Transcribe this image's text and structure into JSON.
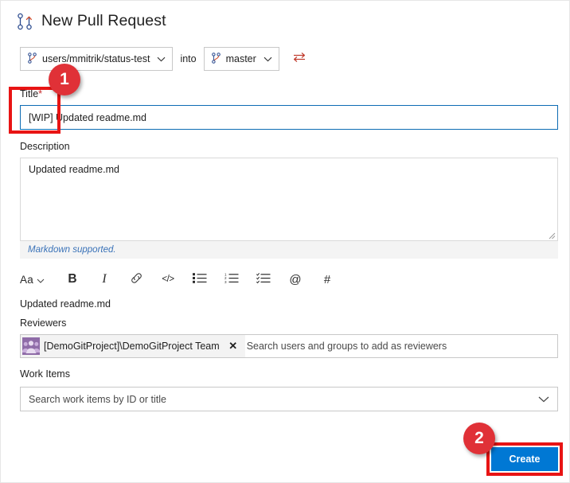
{
  "header": {
    "title": "New Pull Request",
    "icon": "pull-request-icon"
  },
  "branch_row": {
    "source_branch": "users/mmitrik/status-test",
    "into_label": "into",
    "target_branch": "master",
    "swap_icon": "swap-arrows-icon",
    "branch_icon": "branch-icon",
    "chevron_icon": "chevron-down-icon"
  },
  "title_field": {
    "label": "Title",
    "required_marker": "*",
    "value": "[WIP] Updated readme.md",
    "wip_prefix": "[WIP]",
    "rest": " Updated readme.md"
  },
  "description_field": {
    "label": "Description",
    "value": "Updated readme.md",
    "markdown_hint": "Markdown supported."
  },
  "format_toolbar": {
    "buttons": [
      {
        "name": "font-size-button",
        "label": "Aa",
        "icon": "font-size-icon"
      },
      {
        "name": "bold-button",
        "label": "B",
        "icon": "bold-icon"
      },
      {
        "name": "italic-button",
        "label": "I",
        "icon": "italic-icon"
      },
      {
        "name": "link-button",
        "label": "",
        "icon": "link-icon"
      },
      {
        "name": "code-button",
        "label": "</>",
        "icon": "code-icon"
      },
      {
        "name": "bulleted-list-button",
        "label": "",
        "icon": "bulleted-list-icon"
      },
      {
        "name": "numbered-list-button",
        "label": "",
        "icon": "numbered-list-icon"
      },
      {
        "name": "checklist-button",
        "label": "",
        "icon": "checklist-icon"
      },
      {
        "name": "mention-button",
        "label": "@",
        "icon": "at-mention-icon"
      },
      {
        "name": "work-item-link-button",
        "label": "#",
        "icon": "hash-icon"
      }
    ]
  },
  "preview": {
    "text": "Updated readme.md"
  },
  "reviewers_field": {
    "label": "Reviewers",
    "chip": {
      "name": "[DemoGitProject]\\DemoGitProject Team",
      "avatar_icon": "team-group-icon",
      "remove_icon": "close-icon"
    },
    "placeholder": "Search users and groups to add as reviewers"
  },
  "work_items_field": {
    "label": "Work Items",
    "placeholder": "Search work items by ID or title",
    "chevron_icon": "chevron-down-icon"
  },
  "actions": {
    "create_label": "Create"
  },
  "annotations": [
    {
      "number": "1",
      "target": "title-wip-prefix"
    },
    {
      "number": "2",
      "target": "create-button"
    }
  ],
  "colors": {
    "accent_blue": "#0078d4",
    "annotation_red": "#e81414",
    "badge_red": "#e03137",
    "focus_border": "#0d6cb4",
    "markdown_link": "#3a72b8",
    "avatar_purple": "#8f6ca8"
  }
}
